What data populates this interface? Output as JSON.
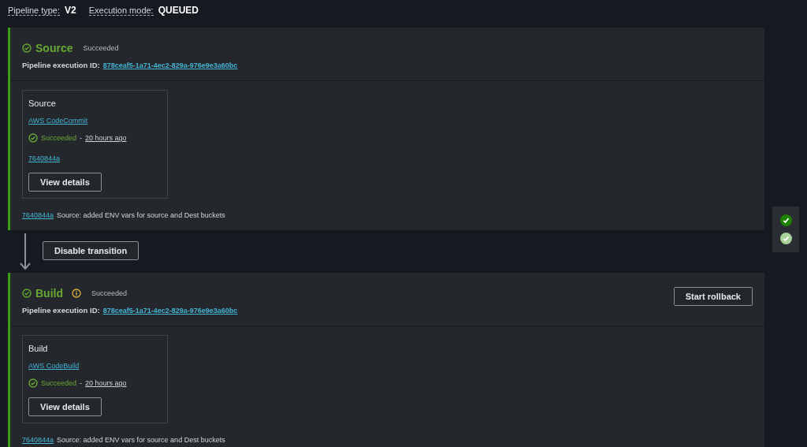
{
  "header": {
    "pipeline_type_label": "Pipeline type:",
    "pipeline_type": "V2",
    "execution_mode_label": "Execution mode:",
    "execution_mode": "QUEUED"
  },
  "stages": [
    {
      "name": "Source",
      "info": false,
      "status": "Succeeded",
      "execution_id_label": "Pipeline execution ID:",
      "execution_id": "878ceaf5-1a71-4ec2-829a-976e9e3a60bc",
      "actions": [
        {
          "name": "Source",
          "provider": "AWS CodeCommit",
          "status": "Succeeded",
          "separator": "-",
          "time": "20 hours ago",
          "revision": "7640844a",
          "button": "View details"
        }
      ],
      "commit": {
        "id": "7640844a",
        "message": "Source: added ENV vars for source and Dest buckets"
      },
      "transition_button": "Disable transition"
    },
    {
      "name": "Build",
      "info": true,
      "status": "Succeeded",
      "execution_id_label": "Pipeline execution ID:",
      "execution_id": "878ceaf5-1a71-4ec2-829a-976e9e3a60bc",
      "rollback_button": "Start rollback",
      "actions": [
        {
          "name": "Build",
          "provider": "AWS CodeBuild",
          "status": "Succeeded",
          "separator": "-",
          "time": "20 hours ago",
          "button": "View details"
        }
      ],
      "commit": {
        "id": "7640844a",
        "message": "Source: added ENV vars for source and Dest buckets"
      }
    }
  ],
  "stage_map": [
    {
      "selected": true
    },
    {
      "selected": false
    }
  ]
}
